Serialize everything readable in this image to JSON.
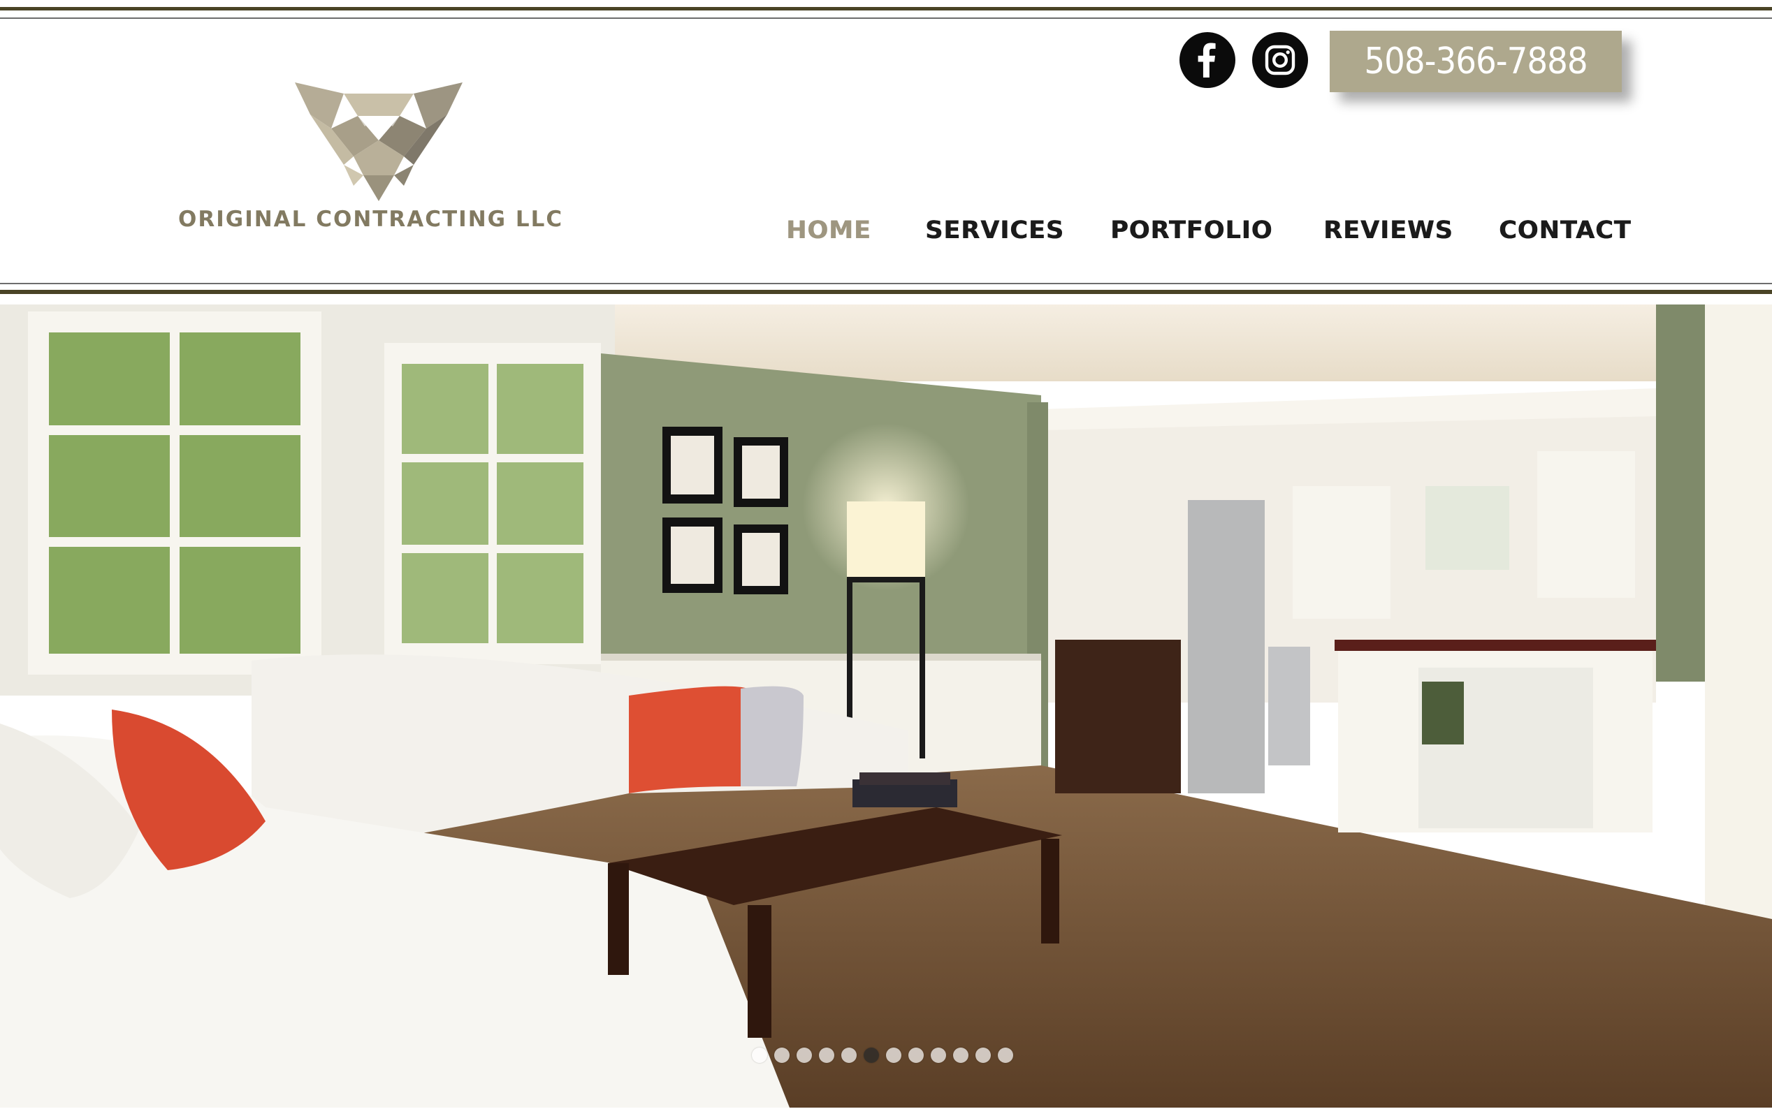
{
  "header": {
    "company_name": "ORIGINAL CONTRACTING LLC",
    "phone": "508-366-7888",
    "social": [
      {
        "icon": "facebook-icon"
      },
      {
        "icon": "instagram-icon"
      }
    ]
  },
  "nav": {
    "items": [
      {
        "label": "HOME",
        "active": true
      },
      {
        "label": "SERVICES",
        "active": false
      },
      {
        "label": "PORTFOLIO",
        "active": false
      },
      {
        "label": "REVIEWS",
        "active": false
      },
      {
        "label": "CONTACT",
        "active": false
      }
    ]
  },
  "slideshow": {
    "slide_count": 12,
    "current_slide": 6
  },
  "colors": {
    "brand_rule": "#4a4426",
    "brand_tan": "#aea88d",
    "logo_text": "#827a61",
    "nav_active": "#9e9680",
    "nav_text": "#1b1b1b"
  }
}
